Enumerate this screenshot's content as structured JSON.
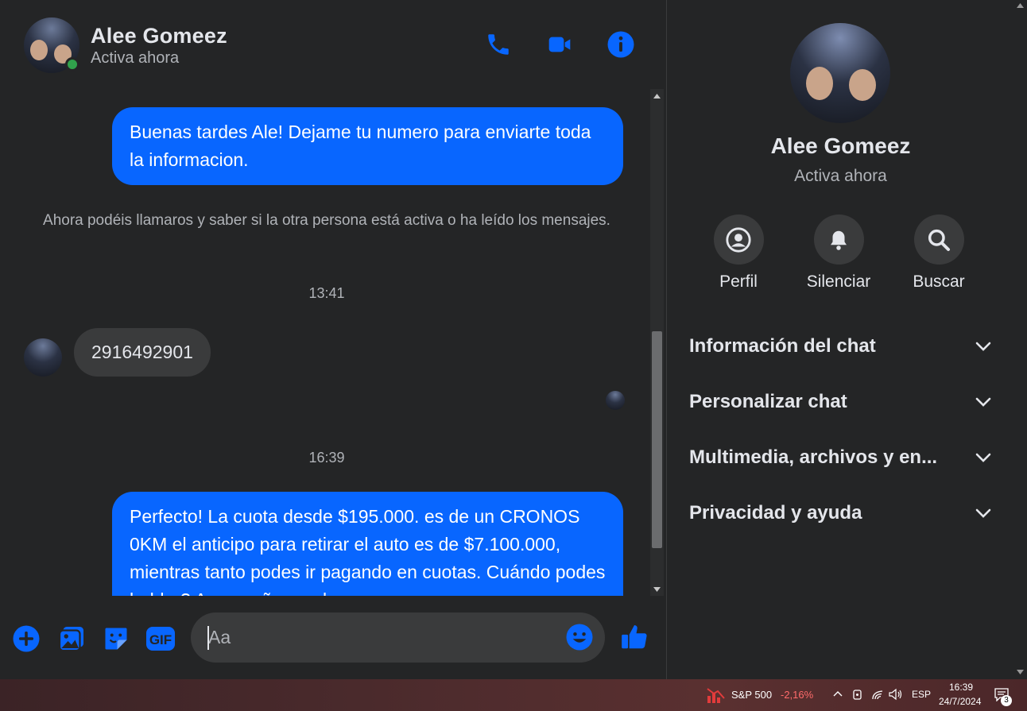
{
  "header": {
    "name": "Alee Gomeez",
    "status": "Activa ahora",
    "icons": [
      "phone-icon",
      "video-icon",
      "info-icon"
    ]
  },
  "messages": {
    "msg1": "Buenas tardes Ale! Dejame tu numero para enviarte toda la informacion.",
    "system_note": "Ahora podéis llamaros y saber si la otra persona está activa o ha leído los mensajes.",
    "time1": "13:41",
    "incoming": "2916492901",
    "time2": "16:39",
    "msg2": "Perfecto! La cuota desde $195.000. es de un CRONOS 0KM el anticipo para retirar el auto es de $7.100.000, mientras tanto podes ir pagando en cuotas. Cuándo podes hablar? Acompaño en el"
  },
  "composer": {
    "placeholder": "Aa",
    "icons": [
      "plus-icon",
      "image-icon",
      "sticker-icon",
      "gif-icon",
      "emoji-icon",
      "like-icon"
    ]
  },
  "info_panel": {
    "name": "Alee Gomeez",
    "status": "Activa ahora",
    "actions": [
      {
        "label": "Perfil",
        "icon": "profile-icon"
      },
      {
        "label": "Silenciar",
        "icon": "bell-icon"
      },
      {
        "label": "Buscar",
        "icon": "search-icon"
      }
    ],
    "sections": [
      "Información del chat",
      "Personalizar chat",
      "Multimedia, archivos y en...",
      "Privacidad y ayuda"
    ]
  },
  "taskbar": {
    "stock_name": "S&P 500",
    "stock_change": "-2,16%",
    "language": "ESP",
    "time": "16:39",
    "date": "24/7/2024",
    "notification_count": "3"
  },
  "colors": {
    "accent": "#0866ff",
    "background": "#242526",
    "bubble_in": "#3a3b3c",
    "online": "#31a24c",
    "negative": "#ff6b6b"
  }
}
